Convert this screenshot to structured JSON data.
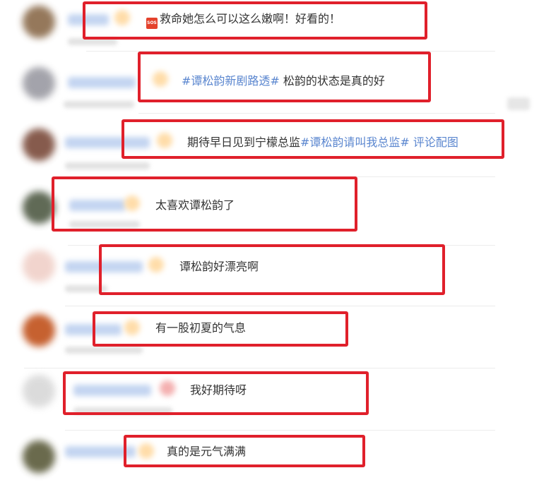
{
  "comments": [
    {
      "sos_icon": "sos-icon",
      "text": "救命她怎么可以这么嫩啊！好看的！"
    },
    {
      "hashtag": "#谭松韵新剧路透#",
      "text": " 松韵的状态是真的好"
    },
    {
      "text": "期待早日见到宁檬总监",
      "hashtag": "#谭松韵请叫我总监#",
      "link": " 评论配图"
    },
    {
      "text": "太喜欢谭松韵了"
    },
    {
      "text": "谭松韵好漂亮啊"
    },
    {
      "text": "有一股初夏的气息"
    },
    {
      "text": "我好期待呀"
    },
    {
      "text": "真的是元气满满"
    }
  ],
  "colors": {
    "highlight_box": "#e0202b",
    "hashtag": "#5a86cf",
    "text": "#333333"
  }
}
